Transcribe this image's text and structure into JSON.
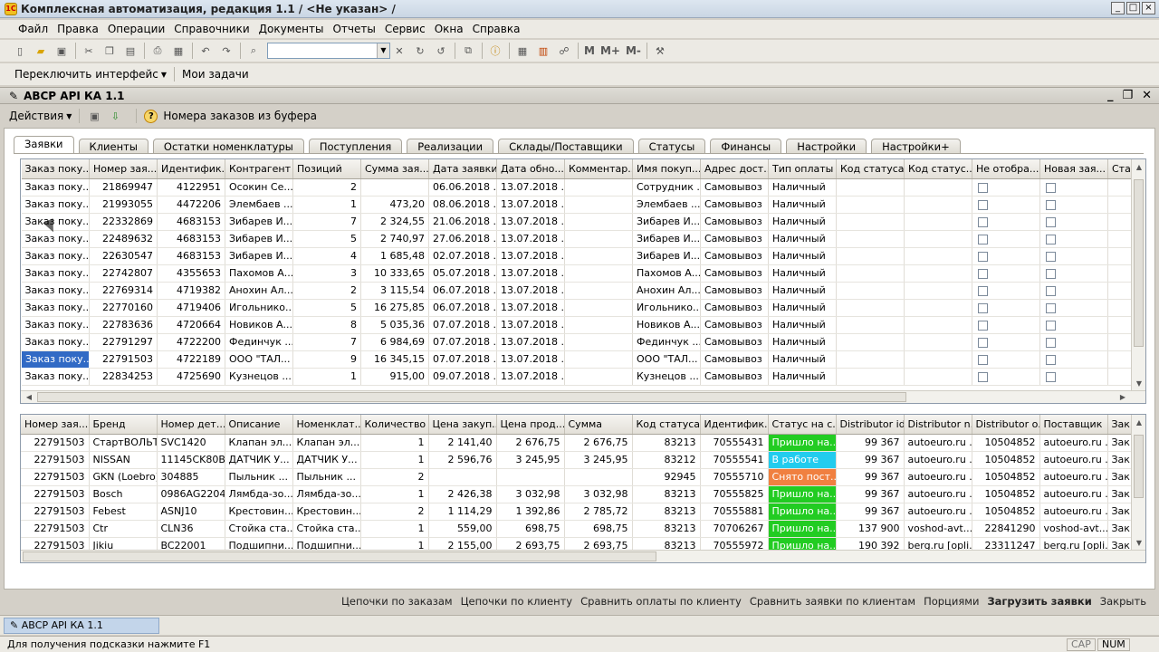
{
  "window": {
    "title": "Комплексная автоматизация, редакция 1.1 / <Не указан> /",
    "app_icon_text": "1С"
  },
  "menu": [
    "Файл",
    "Правка",
    "Операции",
    "Справочники",
    "Документы",
    "Отчеты",
    "Сервис",
    "Окна",
    "Справка"
  ],
  "toolbar": {
    "m_label": "M",
    "mplus_label": "M+",
    "mminus_label": "M-"
  },
  "toolbar2": {
    "switch_interface": "Переключить интерфейс",
    "my_tasks": "Мои задачи"
  },
  "subwindow": {
    "title": "АВСР API КА 1.1"
  },
  "actionbar": {
    "actions": "Действия",
    "buffer": "Номера заказов из буфера"
  },
  "tabs": [
    "Заявки",
    "Клиенты",
    "Остатки номенклатуры",
    "Поступления",
    "Реализации",
    "Склады/Поставщики",
    "Статусы",
    "Финансы",
    "Настройки",
    "Настройки+"
  ],
  "orders": {
    "columns": [
      "Заказ поку...",
      "Номер зая...",
      "Идентифик...",
      "Контрагент",
      "Позиций",
      "Сумма зая...",
      "Дата заявки",
      "Дата обно...",
      "Комментар...",
      "Имя покуп...",
      "Адрес дост...",
      "Тип оплаты",
      "Код статуса",
      "Код статус...",
      "Не отобра...",
      "Новая зая...",
      "Ста"
    ],
    "rows": [
      [
        "Заказ поку...",
        "21869947",
        "4122951",
        "Осокин Се...",
        "2",
        "",
        "06.06.2018 ...",
        "13.07.2018 ...",
        "",
        "Сотрудник ...",
        "Самовывоз",
        "Наличный"
      ],
      [
        "Заказ поку...",
        "21993055",
        "4472206",
        "Элембаев ...",
        "1",
        "473,20",
        "08.06.2018 ...",
        "13.07.2018 ...",
        "",
        "Элембаев ...",
        "Самовывоз",
        "Наличный"
      ],
      [
        "Заказ поку...",
        "22332869",
        "4683153",
        "Зибарев И...",
        "7",
        "2 324,55",
        "21.06.2018 ...",
        "13.07.2018 ...",
        "",
        "Зибарев И...",
        "Самовывоз",
        "Наличный"
      ],
      [
        "Заказ поку...",
        "22489632",
        "4683153",
        "Зибарев И...",
        "5",
        "2 740,97",
        "27.06.2018 ...",
        "13.07.2018 ...",
        "",
        "Зибарев И...",
        "Самовывоз",
        "Наличный"
      ],
      [
        "Заказ поку...",
        "22630547",
        "4683153",
        "Зибарев И...",
        "4",
        "1 685,48",
        "02.07.2018 ...",
        "13.07.2018 ...",
        "",
        "Зибарев И...",
        "Самовывоз",
        "Наличный"
      ],
      [
        "Заказ поку...",
        "22742807",
        "4355653",
        "Пахомов А...",
        "3",
        "10 333,65",
        "05.07.2018 ...",
        "13.07.2018 ...",
        "",
        "Пахомов А...",
        "Самовывоз",
        "Наличный"
      ],
      [
        "Заказ поку...",
        "22769314",
        "4719382",
        "Анохин Ал...",
        "2",
        "3 115,54",
        "06.07.2018 ...",
        "13.07.2018 ...",
        "",
        "Анохин Ал...",
        "Самовывоз",
        "Наличный"
      ],
      [
        "Заказ поку...",
        "22770160",
        "4719406",
        "Игольнико...",
        "5",
        "16 275,85",
        "06.07.2018 ...",
        "13.07.2018 ...",
        "",
        "Игольнико...",
        "Самовывоз",
        "Наличный"
      ],
      [
        "Заказ поку...",
        "22783636",
        "4720664",
        "Новиков А...",
        "8",
        "5 035,36",
        "07.07.2018 ...",
        "13.07.2018 ...",
        "",
        "Новиков А...",
        "Самовывоз",
        "Наличный"
      ],
      [
        "Заказ поку...",
        "22791297",
        "4722200",
        "Фединчук ...",
        "7",
        "6 984,69",
        "07.07.2018 ...",
        "13.07.2018 ...",
        "",
        "Фединчук ...",
        "Самовывоз",
        "Наличный"
      ],
      [
        "Заказ поку...",
        "22791503",
        "4722189",
        "ООО \"ТАЛ...",
        "9",
        "16 345,15",
        "07.07.2018 ...",
        "13.07.2018 ...",
        "",
        "ООО \"ТАЛ...",
        "Самовывоз",
        "Наличный"
      ],
      [
        "Заказ поку...",
        "22834253",
        "4725690",
        "Кузнецов ...",
        "1",
        "915,00",
        "09.07.2018 ...",
        "13.07.2018 ...",
        "",
        "Кузнецов ...",
        "Самовывоз",
        "Наличный"
      ]
    ]
  },
  "lines": {
    "columns": [
      "Номер зая...",
      "Бренд",
      "Номер дет...",
      "Описание",
      "Номенклат...",
      "Количество",
      "Цена закуп...",
      "Цена прод...",
      "Сумма",
      "Код статуса",
      "Идентифик...",
      "Статус на с...",
      "Distributor id",
      "Distributor n...",
      "Distributor o...",
      "Поставщик",
      "Зак"
    ],
    "rows": [
      [
        "22791503",
        "СтартВОЛЬТ",
        "SVC1420",
        "Клапан эл...",
        "Клапан эл...",
        "1",
        "2 141,40",
        "2 676,75",
        "2 676,75",
        "83213",
        "70555431",
        "Пришло на...",
        "99 367",
        "autoeuro.ru ...",
        "10504852",
        "autoeuro.ru ...",
        "Зак"
      ],
      [
        "22791503",
        "NISSAN",
        "11145CK80B",
        "ДАТЧИК У...",
        "ДАТЧИК У...",
        "1",
        "2 596,76",
        "3 245,95",
        "3 245,95",
        "83212",
        "70555541",
        "В работе",
        "99 367",
        "autoeuro.ru ...",
        "10504852",
        "autoeuro.ru ...",
        "Зак"
      ],
      [
        "22791503",
        "GKN (Loebro)",
        "304885",
        "Пыльник ...",
        "Пыльник ...",
        "2",
        "",
        "",
        "",
        "92945",
        "70555710",
        "Снято пост...",
        "99 367",
        "autoeuro.ru ...",
        "10504852",
        "autoeuro.ru ...",
        "Зак"
      ],
      [
        "22791503",
        "Bosch",
        "0986AG2204",
        "Лямбда-зо...",
        "Лямбда-зо...",
        "1",
        "2 426,38",
        "3 032,98",
        "3 032,98",
        "83213",
        "70555825",
        "Пришло на...",
        "99 367",
        "autoeuro.ru ...",
        "10504852",
        "autoeuro.ru ...",
        "Зак"
      ],
      [
        "22791503",
        "Febest",
        "ASNJ10",
        "Крестовин...",
        "Крестовин...",
        "2",
        "1 114,29",
        "1 392,86",
        "2 785,72",
        "83213",
        "70555881",
        "Пришло на...",
        "99 367",
        "autoeuro.ru ...",
        "10504852",
        "autoeuro.ru ...",
        "Зак"
      ],
      [
        "22791503",
        "Ctr",
        "CLN36",
        "Стойка ста...",
        "Стойка ста...",
        "1",
        "559,00",
        "698,75",
        "698,75",
        "83213",
        "70706267",
        "Пришло на...",
        "137 900",
        "voshod-avt...",
        "22841290",
        "voshod-avt...",
        "Зак"
      ],
      [
        "22791503",
        "Jikiu",
        "BC22001",
        "Подшипни...",
        "Подшипни...",
        "1",
        "2 155,00",
        "2 693,75",
        "2 693,75",
        "83213",
        "70555972",
        "Пришло на...",
        "190 392",
        "berg.ru [opli...",
        "23311247",
        "berg.ru [opli...",
        "Зак"
      ]
    ],
    "status_colors": {
      "Пришло на...": "#22cc22",
      "В работе": "#22ccee",
      "Снято пост...": "#f08040"
    }
  },
  "bottom_links": [
    "Цепочки по заказам",
    "Цепочки по клиенту",
    "Сравнить оплаты по клиенту",
    "Сравнить заявки по клиентам",
    "Порциями",
    "Загрузить заявки",
    "Закрыть"
  ],
  "taskbar": {
    "item": "АВСР API КА 1.1"
  },
  "statusbar": {
    "hint": "Для получения подсказки нажмите F1",
    "cap": "CAP",
    "num": "NUM"
  }
}
